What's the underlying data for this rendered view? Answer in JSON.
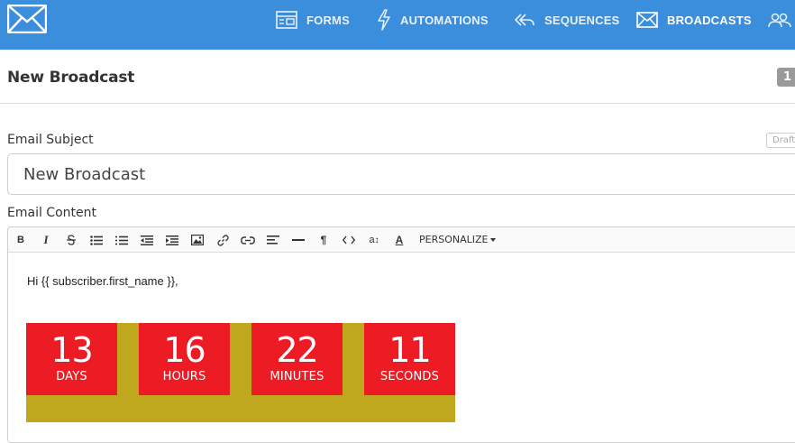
{
  "nav": {
    "items": [
      {
        "label": "FORMS",
        "icon": "forms-icon"
      },
      {
        "label": "AUTOMATIONS",
        "icon": "lightning-icon"
      },
      {
        "label": "SEQUENCES",
        "icon": "sequences-icon"
      },
      {
        "label": "BROADCASTS",
        "icon": "envelope-icon",
        "active": true
      },
      {
        "label": "",
        "icon": "subscribers-icon"
      }
    ],
    "accent": "#3a8edb"
  },
  "header": {
    "title": "New Broadcast",
    "count": "1"
  },
  "subject": {
    "label": "Email Subject",
    "value": "New Broadcast",
    "status": "Draft"
  },
  "content": {
    "label": "Email Content",
    "toolbar": {
      "buttons": [
        "bold-icon",
        "italic-icon",
        "strikethrough-icon",
        "bullet-list-icon",
        "numbered-list-icon",
        "outdent-icon",
        "indent-icon",
        "image-icon",
        "link-icon",
        "unlink-icon",
        "align-icon",
        "horizontal-rule-icon",
        "paragraph-icon",
        "code-icon",
        "font-size-icon",
        "text-color-icon"
      ],
      "personalize_label": "PERSONALIZE"
    },
    "greeting": "Hi {{ subscriber.first_name }},",
    "countdown": {
      "box_color": "#ed1b24",
      "background_color": "#c0a81e",
      "units": [
        {
          "value": "13",
          "label": "DAYS"
        },
        {
          "value": "16",
          "label": "HOURS"
        },
        {
          "value": "22",
          "label": "MINUTES"
        },
        {
          "value": "11",
          "label": "SECONDS"
        }
      ]
    }
  }
}
